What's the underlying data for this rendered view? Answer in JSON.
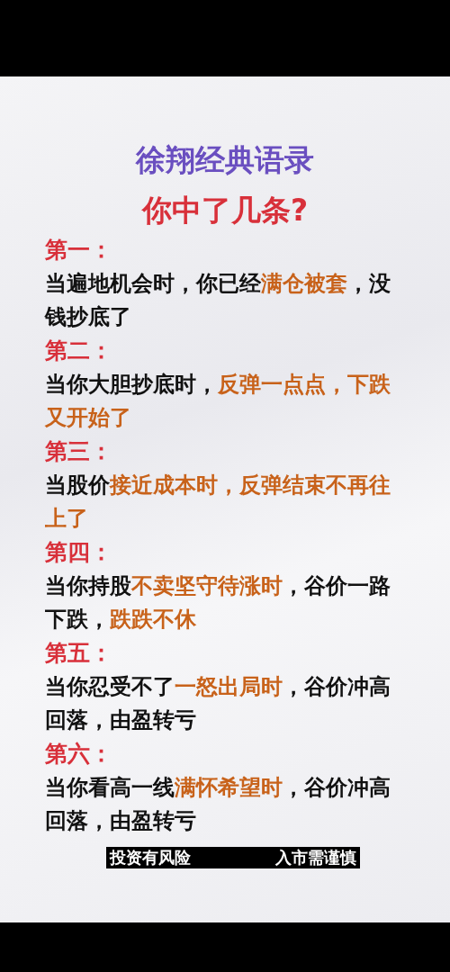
{
  "title": "徐翔经典语录",
  "subtitle": "你中了几条?",
  "items": [
    {
      "heading": "第一：",
      "segments": [
        {
          "text": "当遍地机会时，你已经",
          "highlight": false
        },
        {
          "text": "满仓被套",
          "highlight": true
        },
        {
          "text": "，没钱抄底了",
          "highlight": false
        }
      ]
    },
    {
      "heading": "第二：",
      "segments": [
        {
          "text": "当你大胆抄底时，",
          "highlight": false
        },
        {
          "text": "反弹一点点，下跌又开始了",
          "highlight": true
        }
      ]
    },
    {
      "heading": "第三：",
      "segments": [
        {
          "text": "当股价",
          "highlight": false
        },
        {
          "text": "接近成本时，反弹结束不再往上了",
          "highlight": true
        }
      ]
    },
    {
      "heading": "第四：",
      "segments": [
        {
          "text": "当你持股",
          "highlight": false
        },
        {
          "text": "不卖坚守待涨时",
          "highlight": true
        },
        {
          "text": "，谷价一路下跌，",
          "highlight": false
        },
        {
          "text": "跌跌不休",
          "highlight": true
        }
      ]
    },
    {
      "heading": "第五：",
      "segments": [
        {
          "text": "当你忍受不了",
          "highlight": false
        },
        {
          "text": "一怒出局时",
          "highlight": true
        },
        {
          "text": "，谷价冲高回落，由盈转亏",
          "highlight": false
        }
      ]
    },
    {
      "heading": "第六：",
      "segments": [
        {
          "text": "当你看高一线",
          "highlight": false
        },
        {
          "text": "满怀希望时",
          "highlight": true
        },
        {
          "text": "，谷价冲高回落，由盈转亏",
          "highlight": false
        }
      ]
    }
  ],
  "caption": [
    "投资有风险",
    "入市需谨慎"
  ]
}
